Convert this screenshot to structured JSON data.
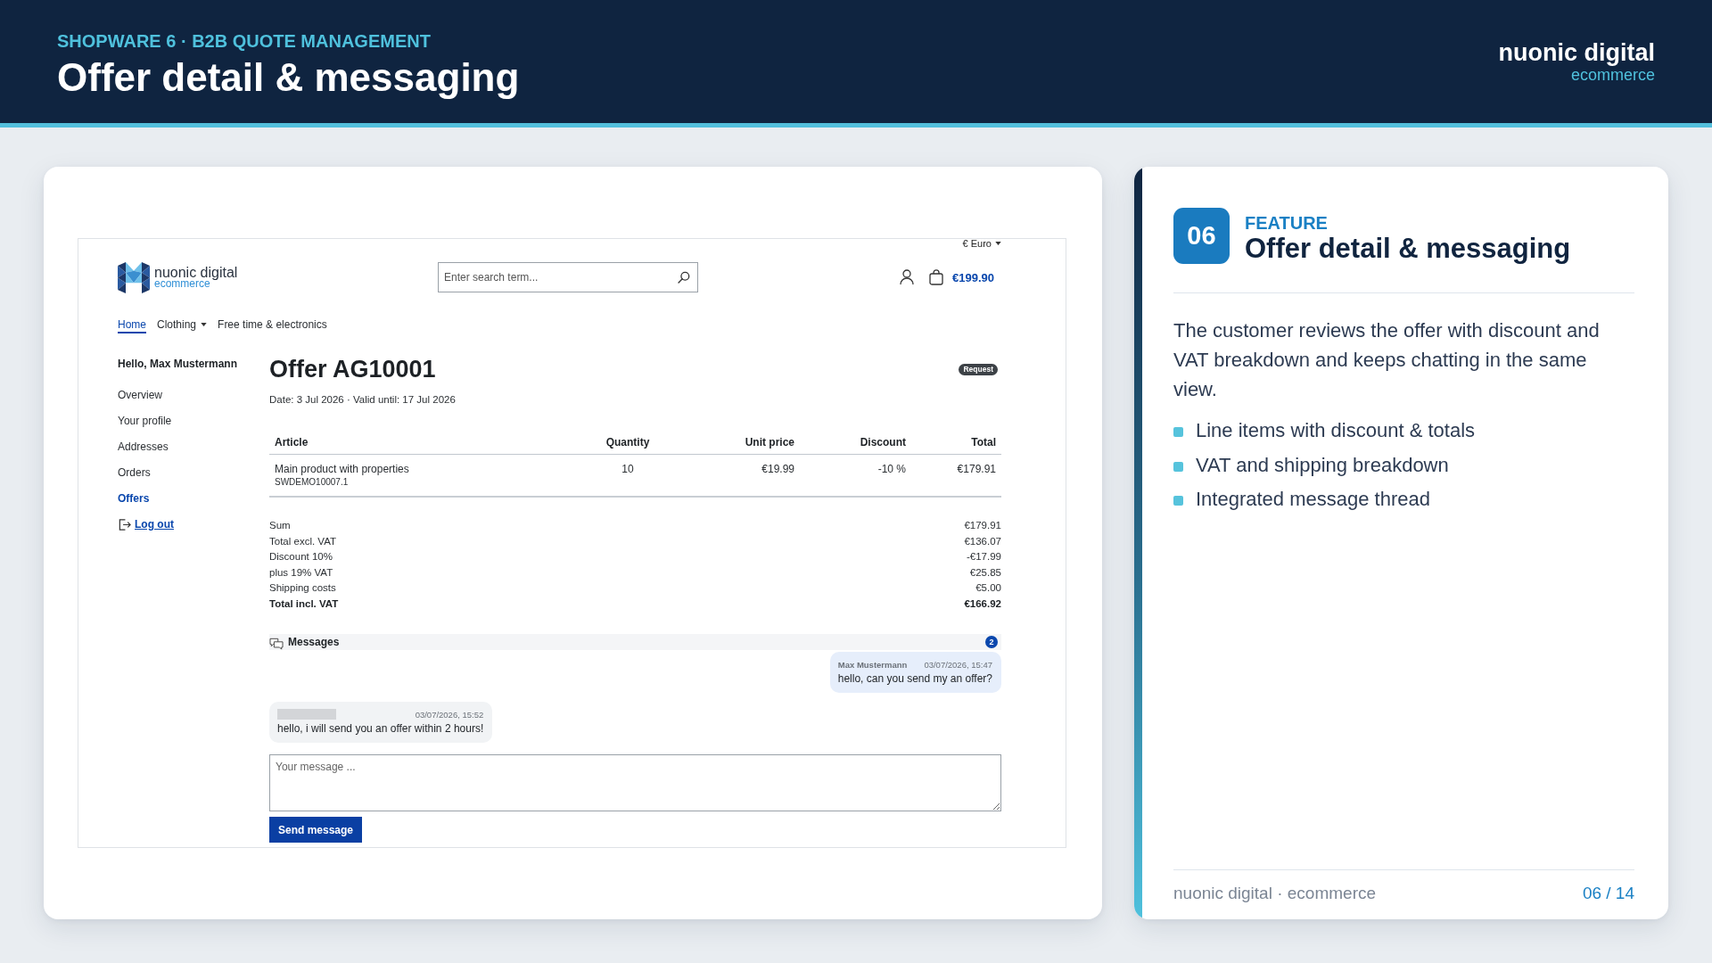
{
  "header": {
    "eyebrow": "SHOPWARE 6 · B2B QUOTE MANAGEMENT",
    "title": "Offer detail & messaging",
    "brand": {
      "name": "nuonic digital",
      "tagline": "ecommerce"
    }
  },
  "shop_preview": {
    "currency": "€ Euro",
    "logo": {
      "name": "nuonic digital",
      "tagline": "ecommerce"
    },
    "search": {
      "placeholder": "Enter search term..."
    },
    "cart_total": "€199.90",
    "nav": [
      {
        "label": "Home",
        "selected": true,
        "dropdown": false
      },
      {
        "label": "Clothing",
        "selected": false,
        "dropdown": true
      },
      {
        "label": "Free time & electronics",
        "selected": false,
        "dropdown": false
      }
    ],
    "account_menu": {
      "greeting": "Hello, Max Mustermann",
      "items": [
        {
          "label": "Overview",
          "selected": false
        },
        {
          "label": "Your profile",
          "selected": false
        },
        {
          "label": "Addresses",
          "selected": false
        },
        {
          "label": "Orders",
          "selected": false
        },
        {
          "label": "Offers",
          "selected": true
        }
      ],
      "logout": "Log out"
    },
    "offer": {
      "title": "Offer AG10001",
      "status": "Request",
      "dates": "Date: 3 Jul 2026 · Valid until: 17 Jul 2026",
      "table": {
        "columns": [
          "Article",
          "Quantity",
          "Unit price",
          "Discount",
          "Total"
        ],
        "rows": [
          {
            "cells": [
              {
                "text": "Main product with properties",
                "sub": "SWDEMO10007.1"
              },
              {
                "text": "10"
              },
              {
                "text": "€19.99"
              },
              {
                "text": "-10 %"
              },
              {
                "text": "€179.91"
              }
            ]
          }
        ]
      },
      "summary": [
        {
          "label": "Sum",
          "value": "€179.91",
          "bold": false
        },
        {
          "label": "Total excl. VAT",
          "value": "€136.07",
          "bold": false
        },
        {
          "label": "Discount 10%",
          "value": "-€17.99",
          "bold": false
        },
        {
          "label": "plus 19% VAT",
          "value": "€25.85",
          "bold": false
        },
        {
          "label": "Shipping costs",
          "value": "€5.00",
          "bold": false
        },
        {
          "label": "Total incl. VAT",
          "value": "€166.92",
          "bold": true
        }
      ]
    },
    "messages": {
      "title": "Messages",
      "count": "2",
      "thread": [
        {
          "kind": "outgoing",
          "author": "Max Mustermann",
          "author_hidden": false,
          "time": "03/07/2026, 15:47",
          "text": "hello, can you send my an offer?"
        },
        {
          "kind": "incoming",
          "author_hidden": true,
          "time": "03/07/2026, 15:52",
          "text": "hello, i will send you an offer within 2 hours!"
        }
      ]
    },
    "composer": {
      "placeholder": "Your message ...",
      "button": "Send message"
    }
  },
  "feature": {
    "number": "06",
    "eyebrow": "FEATURE",
    "title": "Offer detail & messaging",
    "description": "The customer reviews the offer with discount and VAT breakdown and keeps chatting in the same view.",
    "bullets": [
      "Line items with discount & totals",
      "VAT and shipping breakdown",
      "Integrated message thread"
    ],
    "footer": {
      "brand": "nuonic digital · ecommerce",
      "page": "06 / 14"
    }
  }
}
